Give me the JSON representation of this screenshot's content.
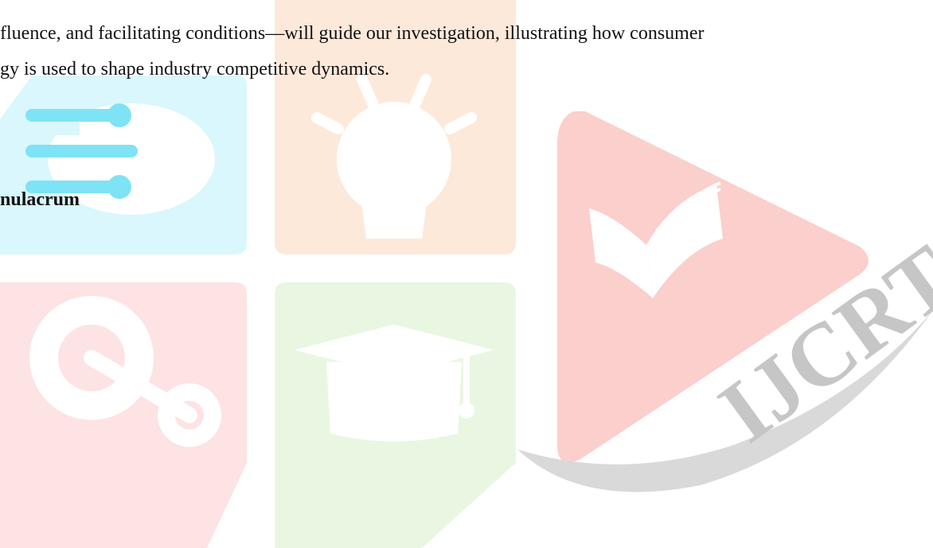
{
  "document": {
    "lines": [
      "fluence, and facilitating conditions—will guide our investigation, illustrating how consumer",
      "gy is used to shape industry competitive dynamics."
    ],
    "heading": "nulacrum"
  },
  "watermark": {
    "logo_text": "IJCRT",
    "icons": [
      "cloud-network-icon",
      "lightbulb-icon",
      "gears-icon",
      "graduation-cap-icon",
      "open-book-icon"
    ],
    "colors": {
      "cyan": "#d9f7fd",
      "orange": "#fde9da",
      "pink": "#fde3e3",
      "green": "#e9f7e2",
      "red": "#fbcfcb",
      "gray_text": "#c6c6c6"
    }
  }
}
